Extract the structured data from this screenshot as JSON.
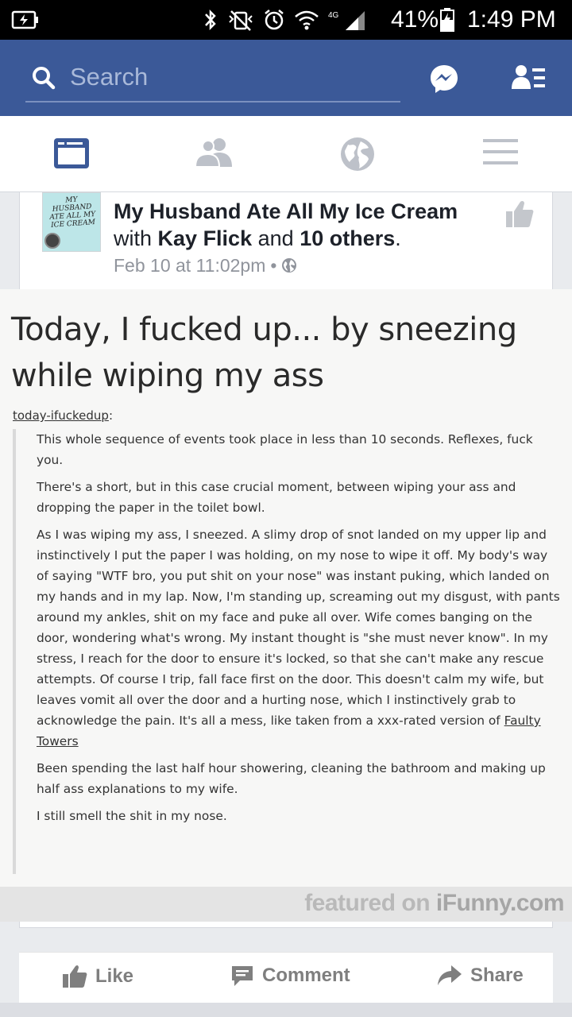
{
  "status_bar": {
    "battery_percent": "41%",
    "time": "1:49 PM"
  },
  "search": {
    "placeholder": "Search"
  },
  "nav": {
    "tabs": [
      "news-feed",
      "friends",
      "notifications",
      "menu"
    ],
    "active": "news-feed",
    "accent_color": "#3b5998"
  },
  "post": {
    "page_name": "My Husband Ate All My Ice Cream",
    "thumb_text": "MY HUSBAND ATE ALL MY ICE CREAM",
    "with_prefix": "with",
    "tagged_person": "Kay Flick",
    "and_text": "and",
    "others": "10 others",
    "period": ".",
    "timestamp": "Feb 10 at 11:02pm",
    "separator": "•"
  },
  "image": {
    "headline": "Today, I fucked up... by sneezing while wiping my ass",
    "source_user": "today-ifuckedup",
    "source_suffix": ":",
    "paragraphs": [
      "This whole sequence of events took place in less than 10 seconds. Reflexes, fuck you.",
      "There's a short, but in this case crucial moment, between wiping your ass and dropping the paper in the toilet bowl.",
      "As I was wiping my ass, I sneezed. A slimy drop of snot landed on my upper lip and instinctively I put the paper I was holding, on my nose to wipe it off. My body's way of saying \"WTF bro, you put shit on your nose\" was instant puking, which landed on my hands and in my lap. Now, I'm standing up, screaming out my disgust, with pants around my ankles, shit on my face and puke all over. Wife comes banging on the door, wondering what's wrong. My instant thought is \"she must never know\". In my stress, I reach for the door to ensure it's locked, so that she can't make any rescue attempts. Of course I trip, fall face first on the door. This doesn't calm my wife, but leaves vomit all over the door and a hurting nose, which I instinctively grab to acknowledge the pain. It's all a mess, like taken from a xxx-rated version of",
      "Been spending the last half hour showering, cleaning the bathroom and making up half ass explanations to my wife.",
      "I still smell the shit in my nose."
    ],
    "link_text": "Faulty Towers",
    "watermark_prefix": "featured on ",
    "watermark_brand": "iFunny.com"
  },
  "actions": {
    "like": "Like",
    "comment": "Comment",
    "share": "Share"
  }
}
